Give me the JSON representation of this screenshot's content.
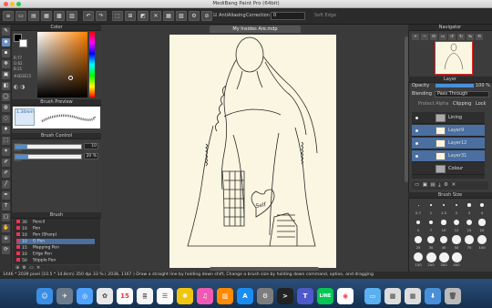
{
  "window": {
    "title": "MediBang Paint Pro (64bit)"
  },
  "toolbar": {
    "antialias_label": "AntiAliasing",
    "correction_label": "Correction",
    "correction_value": "0",
    "soft_edge_label": "Soft Edge"
  },
  "color_panel": {
    "title": "Color",
    "values": [
      "R:77",
      "G:62",
      "B:21"
    ],
    "hex": "#4D3E15",
    "foreground_color": "#000000",
    "background_color": "#ffffff"
  },
  "brush_preview": {
    "title": "Brush Preview",
    "size_label": "1.34mm"
  },
  "brush_control": {
    "title": "Brush Control",
    "size_value": "10",
    "opacity_value": "20 %",
    "size_fraction": 0.18,
    "opacity_fraction": 0.2
  },
  "brush_panel": {
    "title": "Brush",
    "items": [
      {
        "size": "30",
        "name": "Pencil"
      },
      {
        "size": "10",
        "name": "Pen"
      },
      {
        "size": "10",
        "name": "Pen (Sharp)"
      },
      {
        "size": "10",
        "name": "G Pen"
      },
      {
        "size": "15",
        "name": "Mapping Pen"
      },
      {
        "size": "10",
        "name": "Edge Pen"
      },
      {
        "size": "50",
        "name": "Stipple Pen"
      }
    ]
  },
  "document": {
    "tab_title": "My Insides Are.mdp"
  },
  "navigator": {
    "title": "Navigator"
  },
  "layer_panel": {
    "title": "Layer",
    "opacity_label": "Opacity",
    "opacity_value": "100 %",
    "blending_label": "Blending",
    "blending_value": "Pass Through",
    "protect_alpha": "Protect Alpha",
    "clipping": "Clipping",
    "lock": "Lock",
    "layers": [
      {
        "name": "Lining",
        "type": "folder"
      },
      {
        "name": "Layer9",
        "type": "layer"
      },
      {
        "name": "Layer12",
        "type": "layer"
      },
      {
        "name": "Layer31",
        "type": "layer"
      },
      {
        "name": "Colour",
        "type": "folder"
      }
    ]
  },
  "brush_size_panel": {
    "title": "Brush Size",
    "labels": [
      "0.7",
      "1",
      "1.5",
      "2",
      "3",
      "4",
      "5",
      "7",
      "10",
      "12",
      "15",
      "20",
      "25",
      "30",
      "40",
      "50",
      "70",
      "100",
      "150",
      "200",
      "300",
      "400"
    ]
  },
  "status_bar": {
    "text": "1446 * 2039 pixel  (10.5 * 14.8cm)  350 dpi  33 %  ( 2038, 1167 )  Draw a straight line by holding down shift, Change a brush size by holding down command, option, and dragging"
  },
  "dock": {
    "apps": [
      "Finder",
      "Launchpad",
      "Safari",
      "Photos",
      "Calendar",
      "Notes",
      "Reminders",
      "Photos2",
      "iTunes",
      "Books",
      "App Store",
      "System Preferences",
      "Terminal",
      "Teams",
      "LINE",
      "Chrome",
      "Folder",
      "Preview",
      "Preview2",
      "Downloads",
      "Trash"
    ],
    "calendar_day": "15"
  }
}
